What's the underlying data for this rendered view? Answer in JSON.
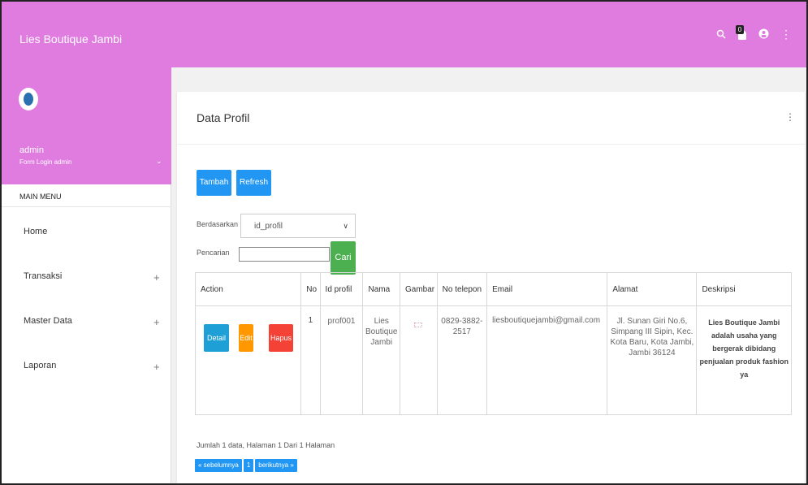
{
  "app": {
    "title": "Lies Boutique Jambi"
  },
  "header_icons": [
    "search-icon",
    "notifications-icon",
    "user-icon",
    "more-vert-icon"
  ],
  "notif_badge": "0",
  "user": {
    "name": "admin",
    "subtitle": "Form Login admin"
  },
  "sidebar": {
    "menu_header": "MAIN MENU",
    "items": [
      {
        "label": "Home",
        "expand": ""
      },
      {
        "label": "Transaksi",
        "expand": "+"
      },
      {
        "label": "Master Data",
        "expand": "+"
      },
      {
        "label": "Laporan",
        "expand": "+"
      }
    ]
  },
  "card": {
    "title": "Data Profil",
    "buttons": {
      "add": "Tambah",
      "refresh": "Refresh",
      "search": "Cari"
    },
    "filter": {
      "by_label": "Berdasarkan",
      "selected": "id_profil",
      "search_label": "Pencarian",
      "search_value": ""
    }
  },
  "table": {
    "headers": [
      "Action",
      "No",
      "Id profil",
      "Nama",
      "Gambar",
      "No telepon",
      "Email",
      "Alamat",
      "Deskripsi"
    ],
    "rows": [
      {
        "actions": {
          "detail": "Detail",
          "edit": "Edit",
          "delete": "Hapus"
        },
        "no": "1",
        "id_profil": "prof001",
        "nama": "Lies Boutique Jambi",
        "gambar": "",
        "telepon": "0829-3882-2517",
        "email": "liesboutiquejambi@gmail.com",
        "alamat": "Jl. Sunan Giri No.6, Simpang III Sipin, Kec. Kota Baru, Kota Jambi, Jambi 36124",
        "deskripsi": "Lies Boutique Jambi adalah usaha yang bergerak dibidang penjualan produk fashion ya"
      }
    ]
  },
  "footer": {
    "info": "Jumlah 1 data, Halaman 1 Dari 1 Halaman",
    "pager": {
      "prev": "« sebelumnya",
      "page": "1",
      "next": "berikutnya »"
    }
  },
  "colors": {
    "header": "#e07be0",
    "primary": "#2196f3",
    "success": "#4caf50",
    "warning": "#ff9800",
    "danger": "#f44336"
  }
}
